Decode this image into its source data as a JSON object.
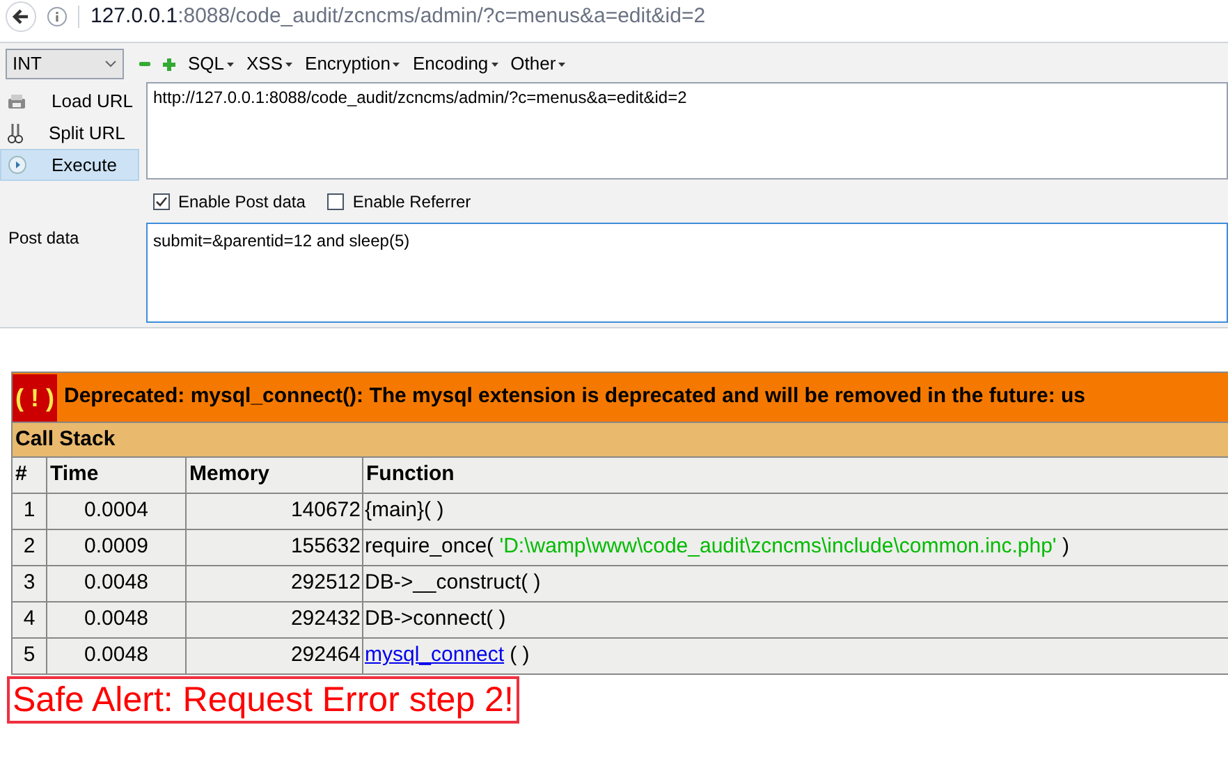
{
  "address_bar": {
    "host": "127.0.0.1",
    "path": ":8088/code_audit/zcncms/admin/?c=menus&a=edit&id=2"
  },
  "toolbar": {
    "type_select": "INT",
    "menus": [
      "SQL",
      "XSS",
      "Encryption",
      "Encoding",
      "Other"
    ]
  },
  "side_actions": [
    {
      "label": "Load URL",
      "kind": "load",
      "selected": false
    },
    {
      "label": "Split URL",
      "kind": "split",
      "selected": false
    },
    {
      "label": "Execute",
      "kind": "execute",
      "selected": true
    }
  ],
  "url_field": {
    "value": "http://127.0.0.1:8088/code_audit/zcncms/admin/?c=menus&a=edit&id=2"
  },
  "options": [
    {
      "label": "Enable Post data",
      "checked": true
    },
    {
      "label": "Enable Referrer",
      "checked": false
    }
  ],
  "post_data": {
    "label": "Post data",
    "value": "submit=&parentid=12 and sleep(5)"
  },
  "error_table": {
    "badge": "( ! )",
    "message": "Deprecated: mysql_connect(): The mysql extension is deprecated and will be removed in the future: us",
    "section": "Call Stack",
    "columns": [
      "#",
      "Time",
      "Memory",
      "Function"
    ],
    "rows": [
      {
        "index": "1",
        "time": "0.0004",
        "memory": "140672",
        "function": {
          "kind": "plain",
          "name": "{main}( )"
        }
      },
      {
        "index": "2",
        "time": "0.0009",
        "memory": "155632",
        "function": {
          "kind": "include",
          "name": "require_once(",
          "arg": "'D:\\wamp\\www\\code_audit\\zcncms\\include\\common.inc.php'",
          "close": ")"
        }
      },
      {
        "index": "3",
        "time": "0.0048",
        "memory": "292512",
        "function": {
          "kind": "plain",
          "name": "DB->__construct( )"
        }
      },
      {
        "index": "4",
        "time": "0.0048",
        "memory": "292432",
        "function": {
          "kind": "plain",
          "name": "DB->connect( )"
        }
      },
      {
        "index": "5",
        "time": "0.0048",
        "memory": "292464",
        "function": {
          "kind": "link",
          "name": "mysql_connect",
          "close": "( )"
        }
      }
    ]
  },
  "alert": "Safe Alert: Request Error step 2!"
}
